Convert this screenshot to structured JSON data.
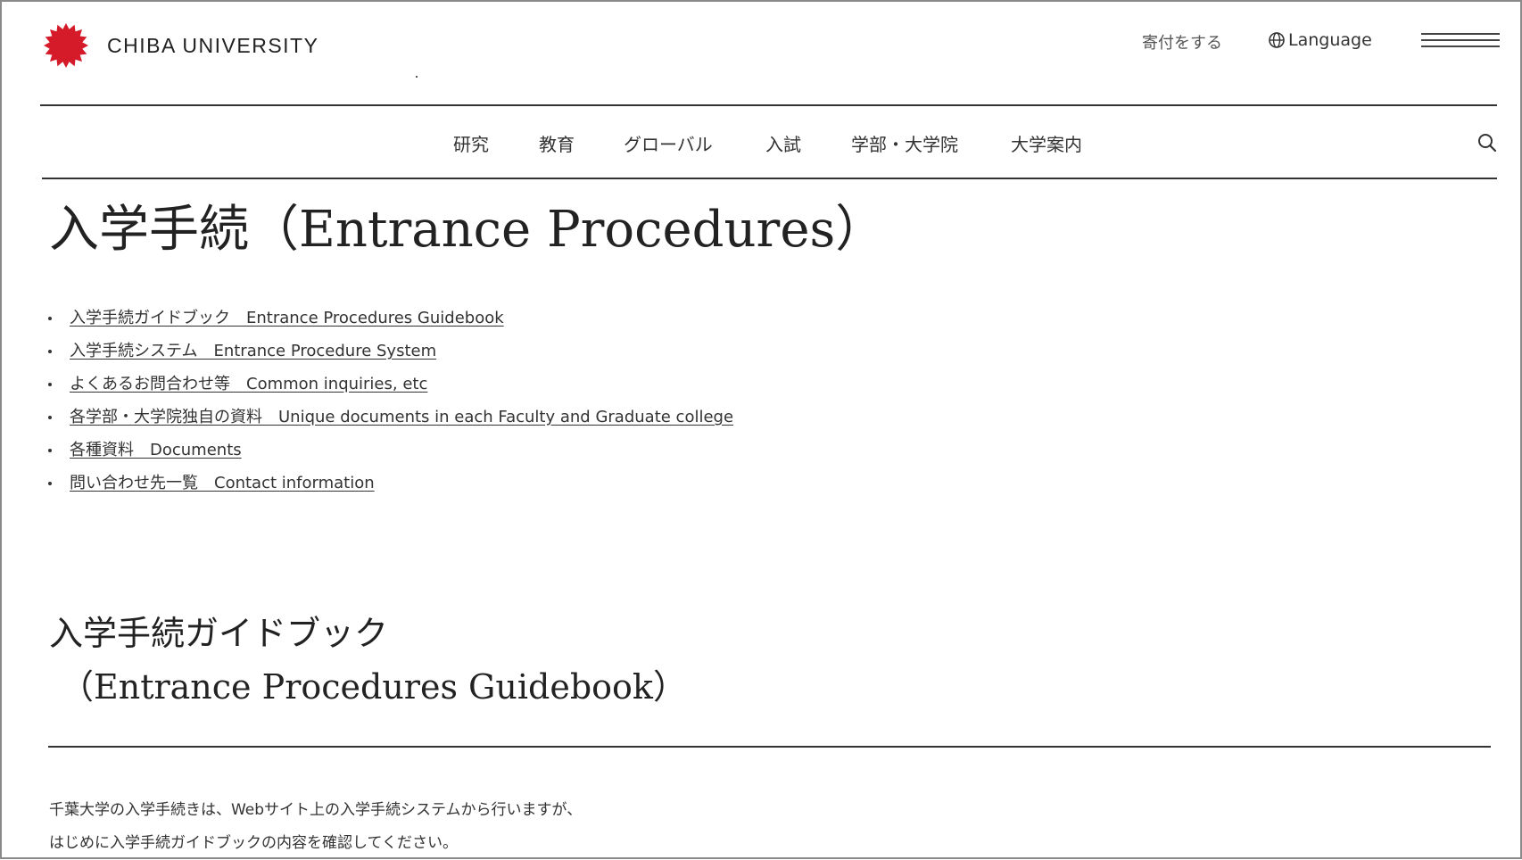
{
  "header": {
    "logo_text": "CHIBA UNIVERSITY",
    "donate": "寄付をする",
    "language": "Language"
  },
  "nav": {
    "items": [
      "研究",
      "教育",
      "グローバル",
      "入試",
      "学部・大学院",
      "大学案内"
    ]
  },
  "main": {
    "title": "入学手続（Entrance Procedures）",
    "links": [
      "入学手続ガイドブック　Entrance Procedures Guidebook",
      "入学手続システム　Entrance Procedure System",
      "よくあるお問合わせ等　Common inquiries, etc",
      "各学部・大学院独自の資料　Unique documents in each Faculty and Graduate college",
      "各種資料　Documents",
      "問い合わせ先一覧　Contact information"
    ]
  },
  "section": {
    "title_line1": "入学手続ガイドブック",
    "title_line2": "（Entrance Procedures Guidebook）",
    "paragraph1": "千葉大学の入学手続きは、Webサイト上の入学手続システムから行いますが、",
    "paragraph2": "はじめに入学手続ガイドブックの内容を確認してください。"
  },
  "colors": {
    "brand_red": "#d51a2a",
    "text": "#222222",
    "rule": "#333333"
  },
  "icons": {
    "logo": "chiba-logo-icon",
    "language": "globe-icon",
    "menu": "hamburger-icon",
    "search": "search-icon"
  }
}
